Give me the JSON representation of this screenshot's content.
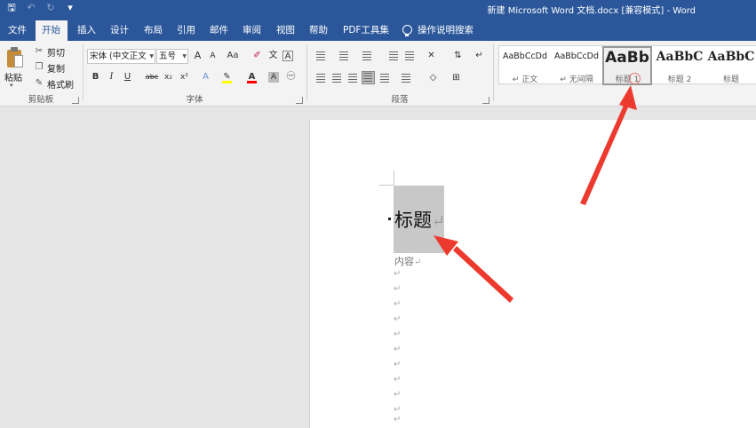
{
  "window": {
    "title": "新建 Microsoft Word 文档.docx [兼容模式] - Word"
  },
  "qat": {
    "save": "🖫",
    "undo": "↶",
    "redo": "↻",
    "more": "▾"
  },
  "tabs": [
    "文件",
    "开始",
    "插入",
    "设计",
    "布局",
    "引用",
    "邮件",
    "审阅",
    "视图",
    "帮助",
    "PDF工具集"
  ],
  "tell_me": "操作说明搜索",
  "clipboard": {
    "paste": "粘贴",
    "cut": "剪切",
    "copy": "复制",
    "format_painter": "格式刷",
    "label": "剪贴板"
  },
  "font": {
    "name": "宋体 (中文正文",
    "size": "五号",
    "grow": "A",
    "shrink": "A",
    "case": "Aa",
    "bold": "B",
    "italic": "I",
    "underline": "U",
    "strike": "abc",
    "subscript": "x₂",
    "superscript": "x²",
    "font_color": "A",
    "char_shade": "A",
    "label": "字体"
  },
  "paragraph": {
    "label": "段落"
  },
  "styles": [
    {
      "sample": "AaBbCcDd",
      "name": "↵ 正文"
    },
    {
      "sample": "AaBbCcDd",
      "name": "↵ 无间隔"
    },
    {
      "sample": "AaBb",
      "name": "标题 1"
    },
    {
      "sample": "AaBbC",
      "name": "标题 2"
    },
    {
      "sample": "AaBbC",
      "name": "标题"
    }
  ],
  "document": {
    "heading": "标题",
    "content": "内容",
    "para_mark": "↵"
  },
  "colors": {
    "accent": "#2b579a",
    "highlight": "#ffff00",
    "font_color": "#ff0000",
    "arrow": "#ec3a2e"
  }
}
